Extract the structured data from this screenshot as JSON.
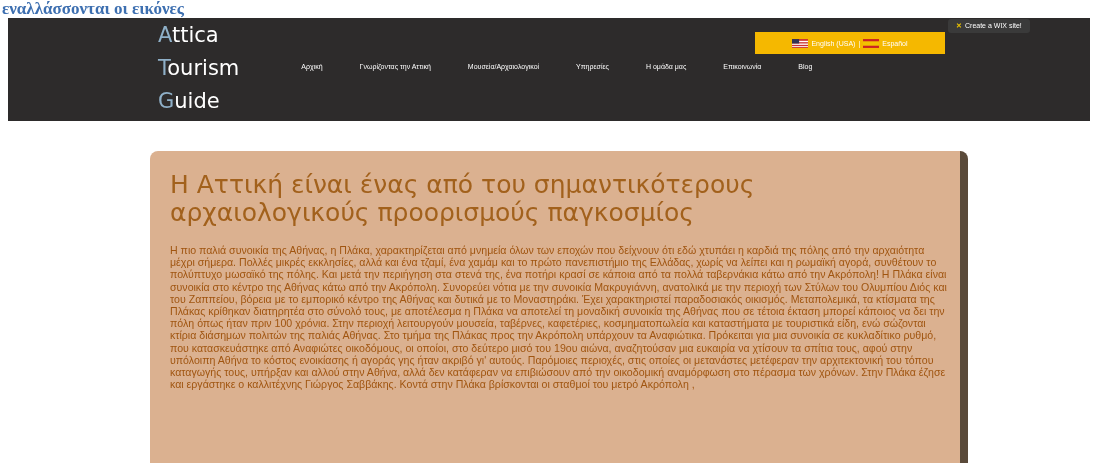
{
  "top_heading": "εναλλάσσονται οι εικόνες",
  "logo": [
    {
      "initial": "A",
      "rest": "ttica"
    },
    {
      "initial": "T",
      "rest": "ourism"
    },
    {
      "initial": "G",
      "rest": "uide"
    }
  ],
  "nav": [
    "Αρχική",
    "Γνωρίζοντας την Αττική",
    "Μουσεία/Αρχαιολογικοί",
    "Υπηρεσίες",
    "Η ομάδα μας",
    "Επικοινωνία",
    "Blog"
  ],
  "language_bar": {
    "english": "English (USA)",
    "separator": "|",
    "spanish": "Español"
  },
  "wix_badge": {
    "icon_text": "✕",
    "label": "Create a WIX site!"
  },
  "article": {
    "title": "Η Αττική είναι ένας από του σημαντικότερους αρχαιολογικούς προορισμούς παγκοσμίος",
    "body": "Η πιο παλιά συνοικία της Αθήνας, η Πλάκα, χαρακτηρίζεται από μνημεία όλων των εποχών που δείχνουν ότι εδώ χτυπάει η καρδιά της πόλης από την αρχαιότητα μέχρι σήμερα. Πολλές μικρές εκκλησίες, αλλά και ένα τζαμί, ένα χαμάμ και το πρώτο πανεπιστήμιο της Ελλάδας, χωρίς να λείπει και η ρωμαϊκή αγορά, συνθέτουν το πολύπτυχο μωσαϊκό της πόλης. Και μετά την περιήγηση στα στενά της, ένα ποτήρι κρασί σε κάποια από τα πολλά ταβερνάκια κάτω από την Ακρόπολη! Η Πλάκα είναι συνοικία στο κέντρο της Αθήνας κάτω από την Ακρόπολη. Συνορεύει νότια με την συνοικία Μακρυγιάννη, ανατολικά με την περιοχή των Στύλων του Ολυμπίου Διός και του Ζαππείου, βόρεια με το εμπορικό κέντρο της Αθήνας και δυτικά με το Μοναστηράκι. Έχει χαρακτηριστεί παραδοσιακός οικισμός. Μεταπολεμικά, τα κτίσματα της Πλάκας κρίθηκαν διατηρητέα στο σύνολό τους, με αποτέλεσμα η Πλάκα να αποτελεί τη μοναδική συνοικία της Αθήνας που σε τέτοια έκταση μπορεί κάποιος να δει την πόλη όπως ήταν πριν 100 χρόνια. Στην περιοχή λειτουργούν μουσεία, ταβέρνες, καφετέριες, κοσμηματοπωλεία και καταστήματα με τουριστικά είδη, ενώ σώζονται κτίρια διάσημων πολιτών της παλιάς Αθήνας. Στο τμήμα της Πλάκας προς την Ακρόπολη υπάρχουν τα Αναφιώτικα. Πρόκειται για μια συνοικία σε κυκλαδίτικο ρυθμό, που κατασκευάστηκε από Αναφιώτες οικοδόμους, οι οποίοι, στο δεύτερο μισό του 19ου αιώνα, αναζητούσαν μια ευκαιρία να χτίσουν τα σπίτια τους, αφού στην υπόλοιπη Αθήνα το κόστος ενοικίασης ή αγοράς γης ήταν ακριβό γι' αυτούς. Παρόμοιες περιοχές, στις οποίες οι μετανάστες μετέφεραν την αρχιτεκτονική του τόπου καταγωγής τους, υπήρξαν και αλλού στην Αθήνα, αλλά δεν κατάφεραν να επιβιώσουν από την οικοδομική αναμόρφωση στο πέρασμα των χρόνων. Στην Πλάκα έζησε και εργάστηκε ο καλλιτέχνης Γιώργος Σαββάκης. Κοντά στην Πλάκα βρίσκονται οι σταθμοί του μετρό Ακρόπολη ,"
  }
}
